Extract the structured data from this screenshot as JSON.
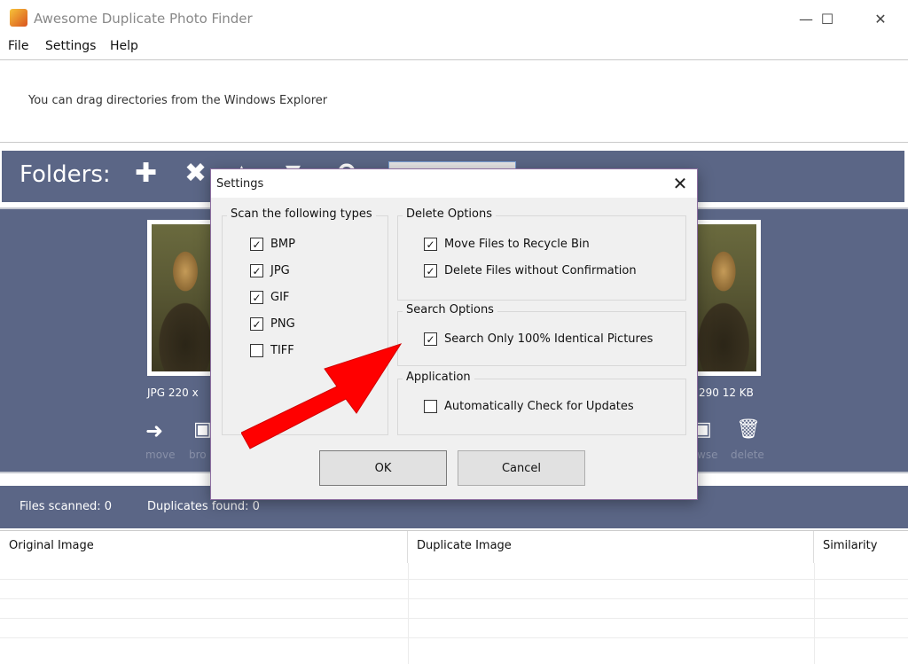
{
  "window": {
    "title": "Awesome Duplicate Photo Finder",
    "minimize": "—",
    "maximize": "☐",
    "close": "✕"
  },
  "menu": {
    "items": [
      "File",
      "Settings",
      "Help"
    ]
  },
  "drag_hint": "You can drag directories from the Windows Explorer",
  "folders": {
    "label": "Folders:",
    "add": "✚",
    "remove": "✖",
    "up": "▲",
    "down": "▼",
    "undo": "↶"
  },
  "preview": {
    "left_info": "JPG  220 x",
    "right_info": "290  12 KB",
    "move_label": "move",
    "browse_left": "bro",
    "browse_right": "wse",
    "delete_label": "delete"
  },
  "stats": {
    "files_scanned": "Files scanned: 0",
    "duplicates_found": "Duplicates found: 0"
  },
  "table": {
    "columns": [
      "Original Image",
      "Duplicate Image",
      "Similarity"
    ]
  },
  "dialog": {
    "title": "Settings",
    "close": "✕",
    "scan_types": {
      "legend": "Scan the following types",
      "items": [
        {
          "label": "BMP",
          "checked": true
        },
        {
          "label": "JPG",
          "checked": true
        },
        {
          "label": "GIF",
          "checked": true
        },
        {
          "label": "PNG",
          "checked": true
        },
        {
          "label": "TIFF",
          "checked": false
        }
      ]
    },
    "delete_options": {
      "legend": "Delete Options",
      "items": [
        {
          "label": "Move Files to Recycle Bin",
          "checked": true
        },
        {
          "label": "Delete Files without Confirmation",
          "checked": true
        }
      ]
    },
    "search_options": {
      "legend": "Search Options",
      "items": [
        {
          "label": "Search Only 100% Identical Pictures",
          "checked": true
        }
      ]
    },
    "application": {
      "legend": "Application",
      "items": [
        {
          "label": "Automatically Check for Updates",
          "checked": false
        }
      ]
    },
    "ok": "OK",
    "cancel": "Cancel"
  },
  "check_mark": "✓",
  "colors": {
    "panel": "#5b6686",
    "arrow": "#ff0000"
  }
}
